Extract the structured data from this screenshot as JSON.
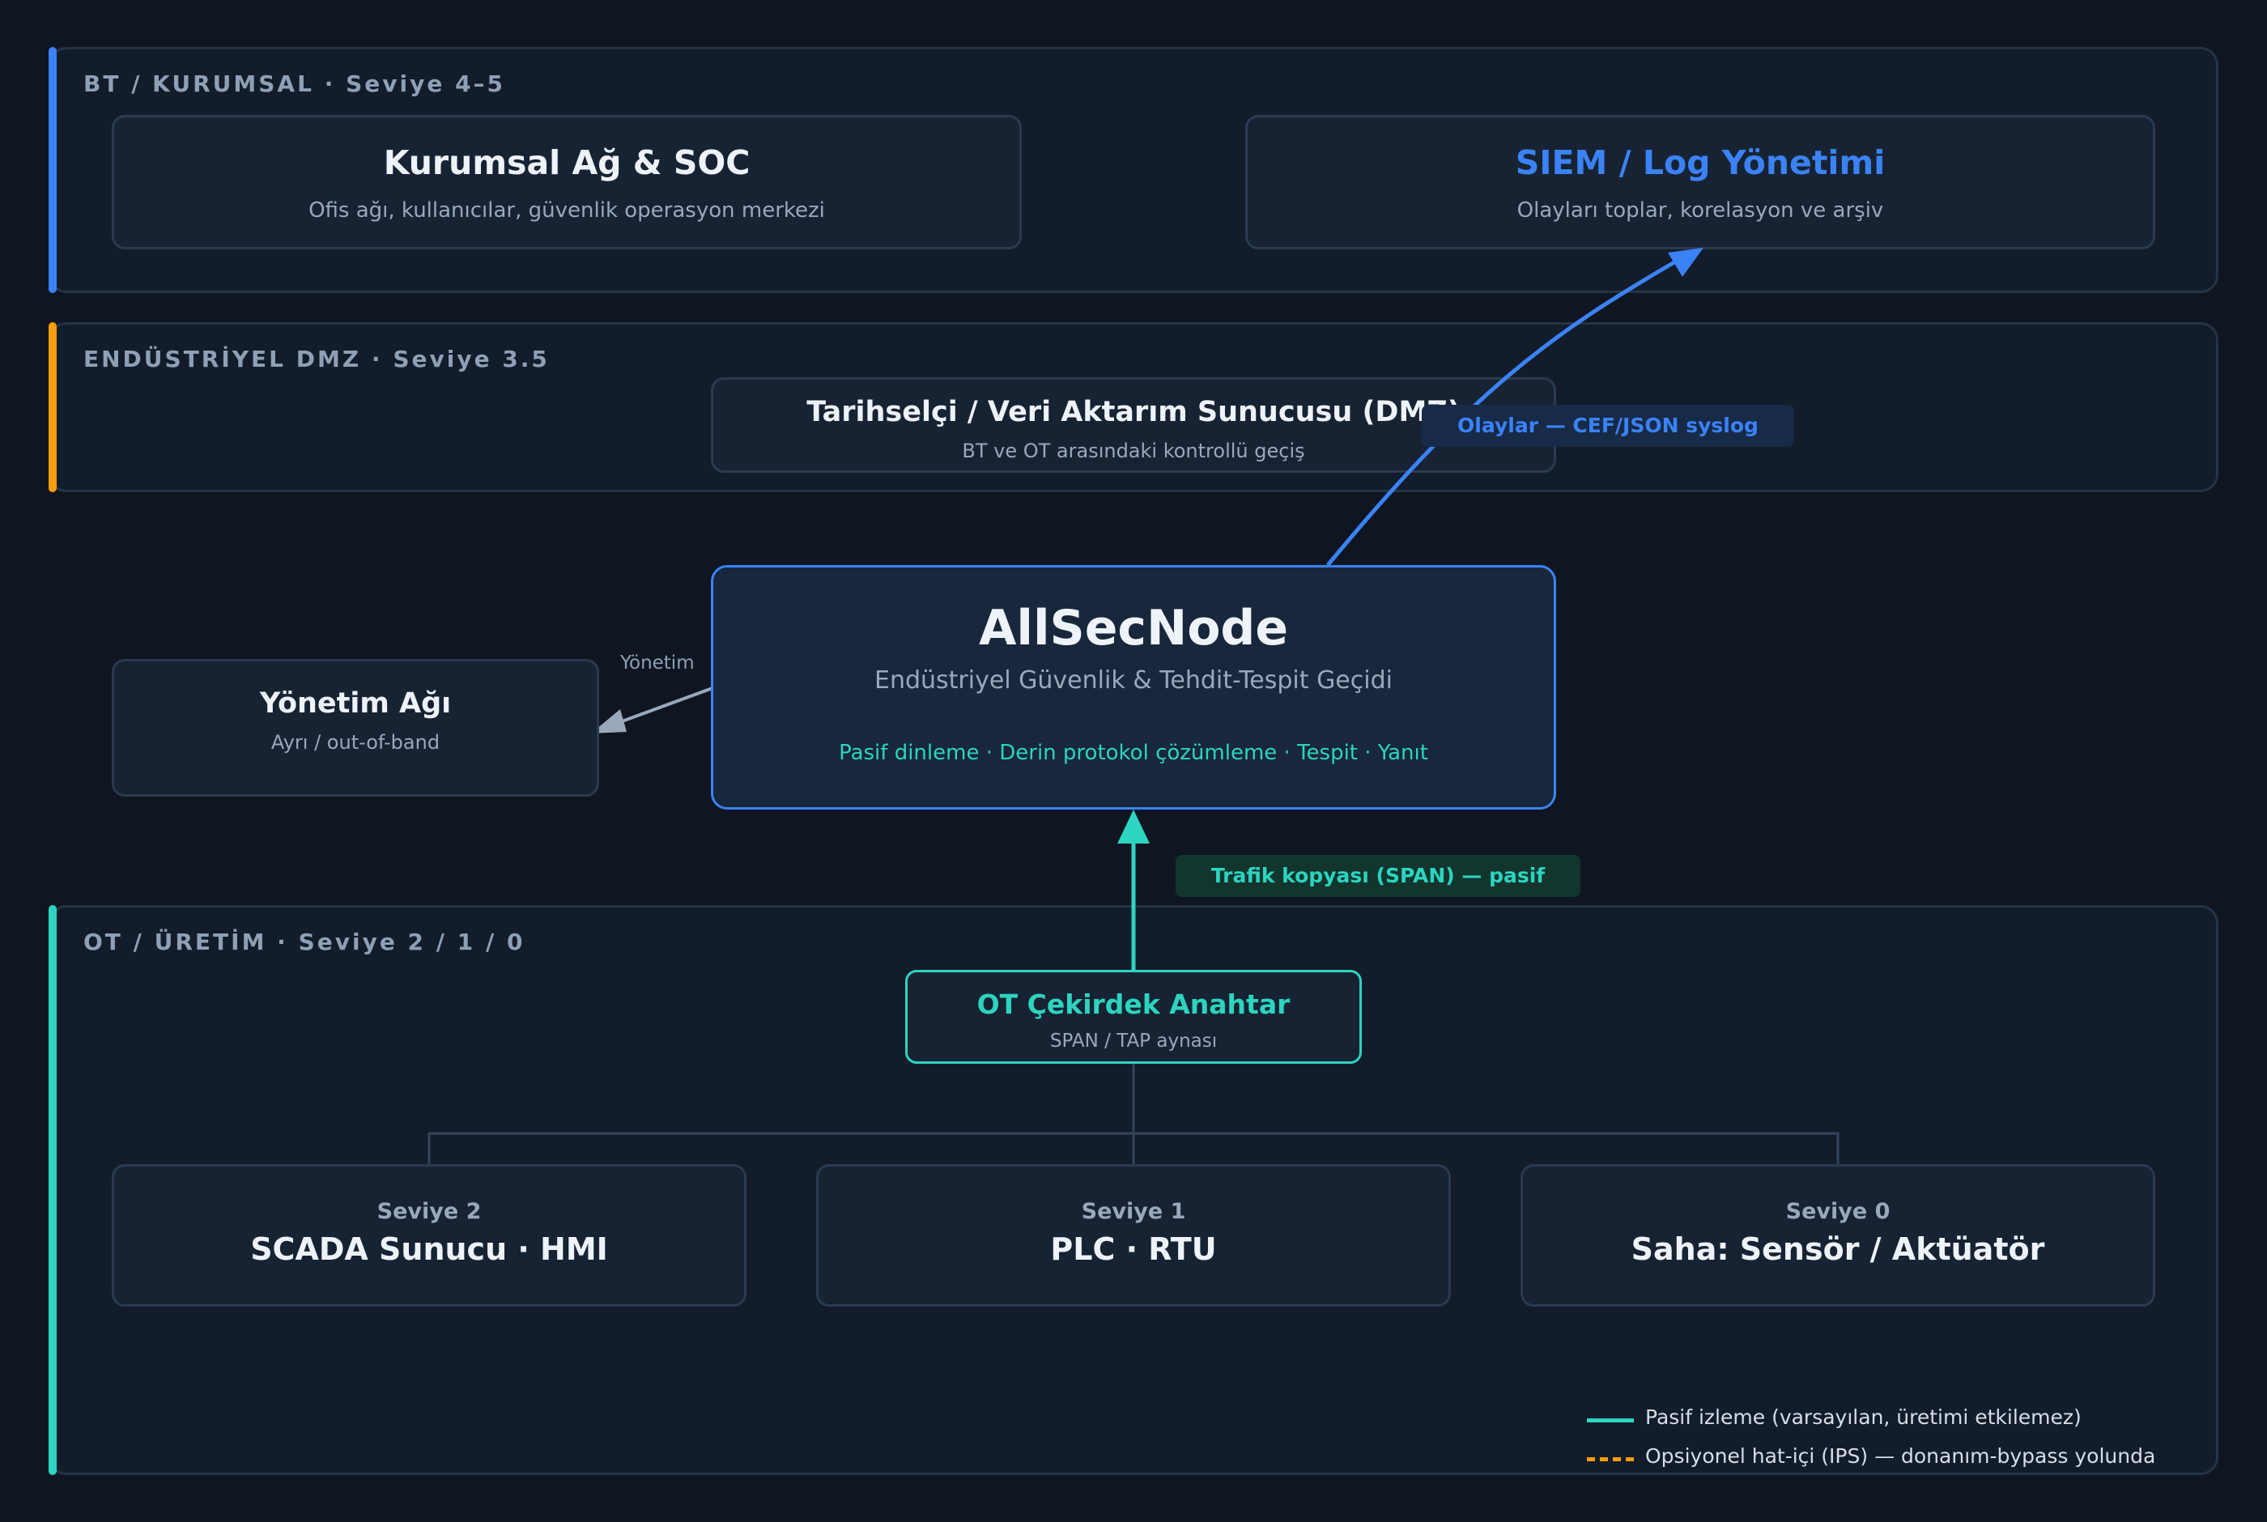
{
  "zones": {
    "it": {
      "label": "BT / KURUMSAL · Seviye 4–5",
      "color": "#3b82f6"
    },
    "dmz": {
      "label": "ENDÜSTRİYEL DMZ · Seviye 3.5",
      "color": "#f59e0b"
    },
    "ot": {
      "label": "OT / ÜRETİM · Seviye 2 / 1 / 0",
      "color": "#2dd4bf"
    }
  },
  "nodes": {
    "corp": {
      "title": "Kurumsal Ağ & SOC",
      "subtitle": "Ofis ağı, kullanıcılar, güvenlik operasyon merkezi"
    },
    "siem": {
      "title": "SIEM / Log Yönetimi",
      "subtitle": "Olayları toplar, korelasyon ve arşiv"
    },
    "historian": {
      "title": "Tarihselçi / Veri Aktarım Sunucusu (DMZ)",
      "subtitle": "BT ve OT arasındaki kontrollü geçiş"
    },
    "allsecnode": {
      "title": "AllSecNode",
      "subtitle": "Endüstriyel Güvenlik & Tehdit-Tespit Geçidi",
      "features": "Pasif dinleme · Derin protokol çözümleme · Tespit · Yanıt"
    },
    "mgmt": {
      "title": "Yönetim Ağı",
      "subtitle": "Ayrı / out-of-band"
    },
    "core_switch": {
      "title": "OT Çekirdek Anahtar",
      "subtitle": "SPAN / TAP aynası"
    },
    "level2": {
      "level": "Seviye 2",
      "title": "SCADA Sunucu · HMI"
    },
    "level1": {
      "level": "Seviye 1",
      "title": "PLC · RTU"
    },
    "level0": {
      "level": "Seviye 0",
      "title": "Saha: Sensör / Aktüatör"
    }
  },
  "edges": {
    "events": "Olaylar — CEF/JSON syslog",
    "management": "Yönetim",
    "span": "Trafik kopyası (SPAN) — pasif"
  },
  "legend": {
    "passive": {
      "label": "Pasif izleme (varsayılan, üretimi etkilemez)",
      "color": "#2dd4bf"
    },
    "inline": {
      "label": "Opsiyonel hat-içi (IPS) — donanım-bypass yolunda",
      "color": "#f59e0b"
    }
  },
  "colors": {
    "accent_blue": "#3b82f6",
    "accent_teal": "#2dd4bf",
    "accent_amber": "#f59e0b",
    "background": "#0f1621"
  }
}
